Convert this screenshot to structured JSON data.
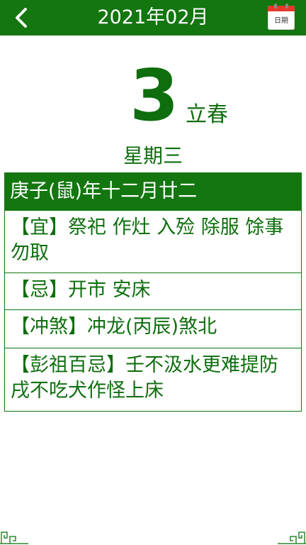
{
  "header": {
    "title": "2021年02月",
    "calendar_button_label": "日期",
    "colors": {
      "bar": "#13760f",
      "calendar_accent": "#e43a2b"
    }
  },
  "date": {
    "day": "3",
    "solar_term": "立春",
    "weekday": "星期三"
  },
  "lunar": {
    "date_text": "庚子(鼠)年十二月廿二"
  },
  "items": [
    {
      "text": "【宜】祭祀 作灶 入殓 除服 馀事勿取"
    },
    {
      "text": "【忌】开市 安床"
    },
    {
      "text": "【冲煞】冲龙(丙辰)煞北"
    },
    {
      "text": "【彭祖百忌】壬不汲水更难提防 戌不吃犬作怪上床"
    }
  ],
  "icons": [
    "back-chevron-icon",
    "calendar-icon",
    "corner-ornament-icon"
  ]
}
